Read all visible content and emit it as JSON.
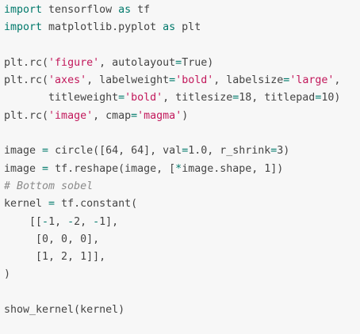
{
  "code": {
    "lines": [
      [
        {
          "t": "import",
          "c": "kw"
        },
        {
          "t": " tensorflow ",
          "c": "tk"
        },
        {
          "t": "as",
          "c": "kw"
        },
        {
          "t": " tf",
          "c": "tk"
        }
      ],
      [
        {
          "t": "import",
          "c": "kw"
        },
        {
          "t": " matplotlib.pyplot ",
          "c": "tk"
        },
        {
          "t": "as",
          "c": "kw"
        },
        {
          "t": " plt",
          "c": "tk"
        }
      ],
      [],
      [
        {
          "t": "plt.rc(",
          "c": "tk"
        },
        {
          "t": "'figure'",
          "c": "str"
        },
        {
          "t": ", autolayout",
          "c": "tk"
        },
        {
          "t": "=",
          "c": "op"
        },
        {
          "t": "True)",
          "c": "tk"
        }
      ],
      [
        {
          "t": "plt.rc(",
          "c": "tk"
        },
        {
          "t": "'axes'",
          "c": "str"
        },
        {
          "t": ", labelweight",
          "c": "tk"
        },
        {
          "t": "=",
          "c": "op"
        },
        {
          "t": "'bold'",
          "c": "str"
        },
        {
          "t": ", labelsize",
          "c": "tk"
        },
        {
          "t": "=",
          "c": "op"
        },
        {
          "t": "'large'",
          "c": "str"
        },
        {
          "t": ",",
          "c": "tk"
        }
      ],
      [
        {
          "t": "       titleweight",
          "c": "tk"
        },
        {
          "t": "=",
          "c": "op"
        },
        {
          "t": "'bold'",
          "c": "str"
        },
        {
          "t": ", titlesize",
          "c": "tk"
        },
        {
          "t": "=",
          "c": "op"
        },
        {
          "t": "18, titlepad",
          "c": "tk"
        },
        {
          "t": "=",
          "c": "op"
        },
        {
          "t": "10)",
          "c": "tk"
        }
      ],
      [
        {
          "t": "plt.rc(",
          "c": "tk"
        },
        {
          "t": "'image'",
          "c": "str"
        },
        {
          "t": ", cmap",
          "c": "tk"
        },
        {
          "t": "=",
          "c": "op"
        },
        {
          "t": "'magma'",
          "c": "str"
        },
        {
          "t": ")",
          "c": "tk"
        }
      ],
      [],
      [
        {
          "t": "image ",
          "c": "tk"
        },
        {
          "t": "=",
          "c": "op"
        },
        {
          "t": " circle([64, 64], val",
          "c": "tk"
        },
        {
          "t": "=",
          "c": "op"
        },
        {
          "t": "1.0, r_shrink",
          "c": "tk"
        },
        {
          "t": "=",
          "c": "op"
        },
        {
          "t": "3)",
          "c": "tk"
        }
      ],
      [
        {
          "t": "image ",
          "c": "tk"
        },
        {
          "t": "=",
          "c": "op"
        },
        {
          "t": " tf.reshape(image, [",
          "c": "tk"
        },
        {
          "t": "*",
          "c": "op"
        },
        {
          "t": "image.shape, 1])",
          "c": "tk"
        }
      ],
      [
        {
          "t": "# Bottom sobel",
          "c": "cm"
        }
      ],
      [
        {
          "t": "kernel ",
          "c": "tk"
        },
        {
          "t": "=",
          "c": "op"
        },
        {
          "t": " tf.constant(",
          "c": "tk"
        }
      ],
      [
        {
          "t": "    [[",
          "c": "tk"
        },
        {
          "t": "-",
          "c": "op"
        },
        {
          "t": "1, ",
          "c": "tk"
        },
        {
          "t": "-",
          "c": "op"
        },
        {
          "t": "2, ",
          "c": "tk"
        },
        {
          "t": "-",
          "c": "op"
        },
        {
          "t": "1],",
          "c": "tk"
        }
      ],
      [
        {
          "t": "     [0, 0, 0],",
          "c": "tk"
        }
      ],
      [
        {
          "t": "     [1, 2, 1]],",
          "c": "tk"
        }
      ],
      [
        {
          "t": ")",
          "c": "tk"
        }
      ],
      [],
      [
        {
          "t": "show_kernel(kernel)",
          "c": "tk"
        }
      ]
    ]
  }
}
